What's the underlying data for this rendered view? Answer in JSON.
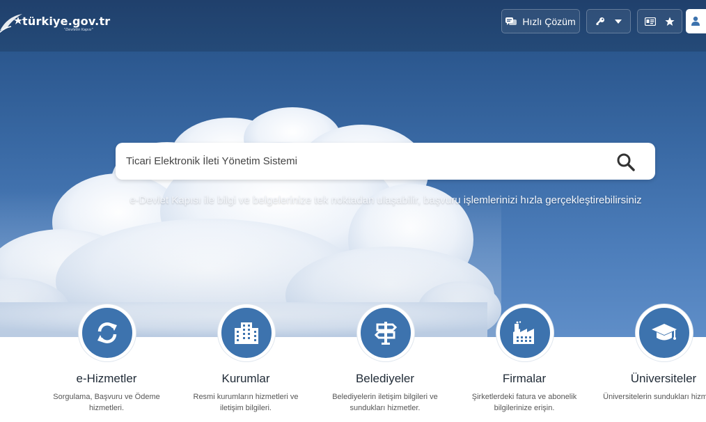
{
  "header": {
    "logo_text": "türkiye.gov.tr",
    "logo_subtitle": "\"Devletin Kapısı\"",
    "quick_solution_label": "Hızlı Çözüm"
  },
  "search": {
    "value": "Ticari Elektronik İleti Yönetim Sistemi"
  },
  "tagline": "e-Devlet Kapısı ile bilgi ve belgelerinize tek noktadan ulaşabilir, başvuru işlemlerinizi hızla gerçekleştirebilirsiniz",
  "categories": [
    {
      "title": "e-Hizmetler",
      "desc": "Sorgulama, Başvuru ve Ödeme hizmetleri.",
      "icon": "refresh-icon"
    },
    {
      "title": "Kurumlar",
      "desc": "Resmi kurumların hizmetleri ve iletişim bilgileri.",
      "icon": "building-icon"
    },
    {
      "title": "Belediyeler",
      "desc": "Belediyelerin iletişim bilgileri ve sundukları hizmetler.",
      "icon": "signpost-icon"
    },
    {
      "title": "Firmalar",
      "desc": "Şirketlerdeki fatura ve abonelik bilgilerinize erişin.",
      "icon": "factory-icon"
    },
    {
      "title": "Üniversiteler",
      "desc": "Üniversitelerin sundukları hizmetler.",
      "icon": "graduation-cap-icon"
    }
  ],
  "colors": {
    "header_bg": "#20406c",
    "category_circle": "#3d73ae",
    "hero_sky": "#3a6aa5"
  }
}
